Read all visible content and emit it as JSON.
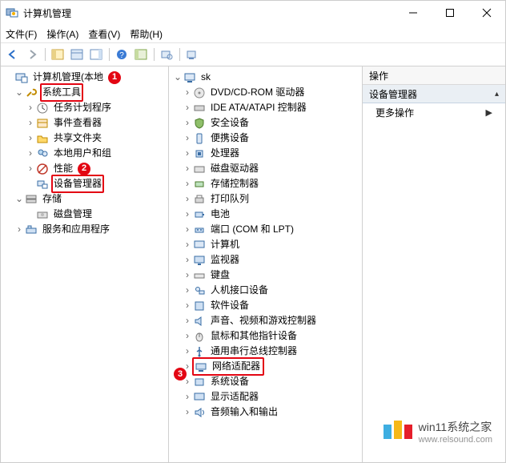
{
  "window": {
    "title": "计算机管理"
  },
  "menu": {
    "file": "文件(F)",
    "action": "操作(A)",
    "view": "查看(V)",
    "help": "帮助(H)"
  },
  "left_tree": {
    "root": "计算机管理(本地",
    "sys_tools": "系统工具",
    "task_sched": "任务计划程序",
    "event_viewer": "事件查看器",
    "shared": "共享文件夹",
    "users": "本地用户和组",
    "perf": "性能",
    "devmgr": "设备管理器",
    "storage": "存储",
    "diskmgmt": "磁盘管理",
    "services": "服务和应用程序"
  },
  "mid_tree": {
    "root": "sk",
    "dvd": "DVD/CD-ROM 驱动器",
    "ide": "IDE ATA/ATAPI 控制器",
    "sec": "安全设备",
    "portable": "便携设备",
    "cpu": "处理器",
    "disk": "磁盘驱动器",
    "storage_ctrl": "存储控制器",
    "print": "打印队列",
    "battery": "电池",
    "ports": "端口 (COM 和 LPT)",
    "computer": "计算机",
    "monitor": "监视器",
    "keyboard": "键盘",
    "hid": "人机接口设备",
    "soft": "软件设备",
    "sound": "声音、视频和游戏控制器",
    "mouse": "鼠标和其他指针设备",
    "usb": "通用串行总线控制器",
    "net": "网络适配器",
    "sysdev": "系统设备",
    "display": "显示适配器",
    "audio": "音频输入和输出"
  },
  "right": {
    "header": "操作",
    "section": "设备管理器",
    "more": "更多操作"
  },
  "badges": {
    "b1": "1",
    "b2": "2",
    "b3": "3"
  },
  "watermark": {
    "title": "win11系统之家",
    "url": "www.relsound.com"
  }
}
